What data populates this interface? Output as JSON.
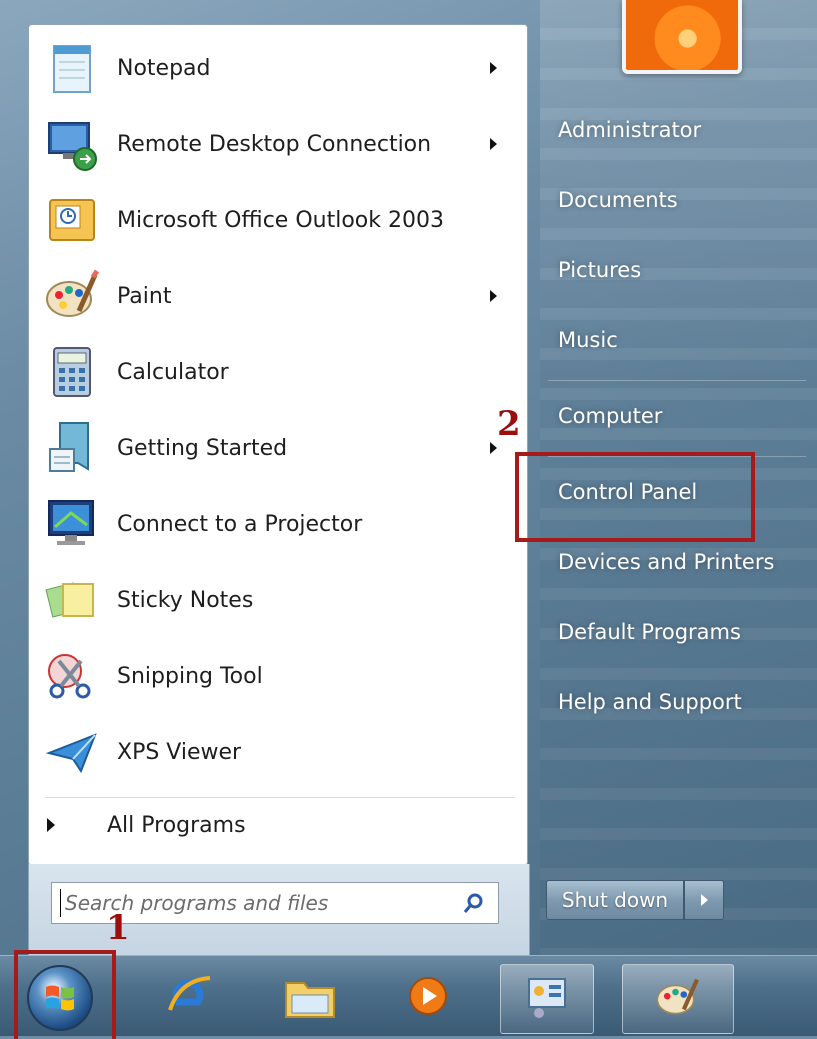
{
  "start_menu": {
    "programs": [
      {
        "label": "Notepad",
        "icon": "notepad-icon",
        "has_submenu": true
      },
      {
        "label": "Remote Desktop Connection",
        "icon": "remote-desktop-icon",
        "has_submenu": true
      },
      {
        "label": "Microsoft Office Outlook 2003",
        "icon": "outlook-icon",
        "has_submenu": false
      },
      {
        "label": "Paint",
        "icon": "paint-icon",
        "has_submenu": true
      },
      {
        "label": "Calculator",
        "icon": "calculator-icon",
        "has_submenu": false
      },
      {
        "label": "Getting Started",
        "icon": "getting-started-icon",
        "has_submenu": true
      },
      {
        "label": "Connect to a Projector",
        "icon": "projector-icon",
        "has_submenu": false
      },
      {
        "label": "Sticky Notes",
        "icon": "sticky-notes-icon",
        "has_submenu": false
      },
      {
        "label": "Snipping Tool",
        "icon": "snipping-tool-icon",
        "has_submenu": false
      },
      {
        "label": "XPS Viewer",
        "icon": "xps-viewer-icon",
        "has_submenu": false
      }
    ],
    "all_programs_label": "All Programs",
    "search_placeholder": "Search programs and files",
    "right_items": [
      {
        "label": "Administrator"
      },
      {
        "label": "Documents"
      },
      {
        "label": "Pictures"
      },
      {
        "label": "Music"
      },
      {
        "label": "Computer"
      },
      {
        "label": "Control Panel"
      },
      {
        "label": "Devices and Printers"
      },
      {
        "label": "Default Programs"
      },
      {
        "label": "Help and Support"
      }
    ],
    "shutdown_label": "Shut down"
  },
  "annotations": {
    "step1": "1",
    "step2": "2",
    "highlight_color": "#a51a1a"
  },
  "taskbar": {
    "items": [
      "start-orb-icon",
      "internet-explorer-icon",
      "windows-explorer-icon",
      "media-player-icon",
      "control-panel-icon",
      "paint-icon"
    ]
  }
}
